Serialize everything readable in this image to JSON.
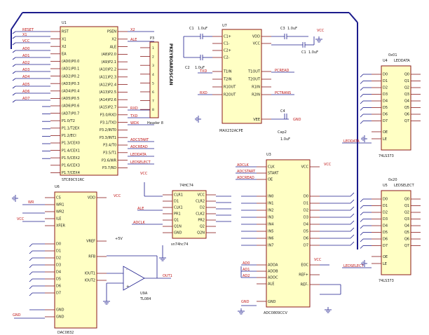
{
  "diagram": {
    "u1": {
      "ref": "U1",
      "part": "STC89C51RC",
      "left_pins": [
        "RST",
        "X1",
        "X2",
        "EA",
        "(AD0)P0.0",
        "(AD1)P0.1",
        "(AD2)P0.2",
        "(AD3)P0.3",
        "(AD4)P0.4",
        "(AD5)P0.5",
        "(AD6)P0.6",
        "(AD7)P0.7",
        "P1.0/T2",
        "P1.1/T2EX",
        "P1.2/ECI",
        "P1.3/CEX0",
        "P1.4/CEX1",
        "P1.5/CEX2",
        "P1.6/CEX3",
        "P1.7/CEX4"
      ],
      "right_pins": [
        "PSEN",
        "X2",
        "ALE",
        "(A8)P2.0",
        "(A9)P2.1",
        "(A10)P2.2",
        "(A11)P2.3",
        "(A12)P2.4",
        "(A13)P2.5",
        "(A14)P2.6",
        "(A15)P2.7",
        "P3.0/RXD",
        "P3.1/TXD",
        "P3.2/INT0",
        "P3.3/INT1",
        "P3.4/T0",
        "P3.5/T1",
        "P3.6/WR",
        "P3.7/RD"
      ],
      "left_nets": [
        "RESET",
        "X1",
        "VCC",
        "AD0",
        "AD1",
        "AD2",
        "AD3",
        "AD4",
        "AD5",
        "AD6",
        "AD7"
      ],
      "right_nets": [
        "X2",
        "ALE",
        "RXD",
        "TXD",
        "WDX",
        "ADCSTART",
        "ADCREAD",
        "LEDDATA",
        "LEDSELECT"
      ]
    },
    "p3": {
      "ref": "P3",
      "part": "Header 8",
      "label": "PKEYBOARDSCAN",
      "pins": [
        "1",
        "2",
        "3",
        "4",
        "5",
        "6",
        "7",
        "8"
      ]
    },
    "u7": {
      "ref": "U7",
      "part": "MAX232ACPE",
      "left_pins": [
        "C1+",
        "C1-",
        "C2+",
        "C2-",
        "T1IN",
        "T2IN",
        "R1OUT",
        "R2OUT"
      ],
      "right_pins": [
        "VDD",
        "VCC",
        "",
        "",
        "T1OUT",
        "T2OUT",
        "R1IN",
        "R2IN",
        "VEE"
      ],
      "left_nets": [
        "TXD",
        "RXD"
      ],
      "right_nets": [
        "PCREAD",
        "PCTRANS",
        "GND"
      ]
    },
    "caps": [
      {
        "ref": "C1",
        "value": "1.0uF"
      },
      {
        "ref": "C2",
        "value": "1.0uF"
      },
      {
        "ref": "C3",
        "value": "1.0uF"
      },
      {
        "ref": "C4",
        "value": "1.0uF"
      },
      {
        "ref": "Cap2",
        "value": "1.0uF"
      }
    ],
    "u4_top": {
      "ref": "U4",
      "part": "74LS373",
      "label": "LEDDATA",
      "top_label": "0x01",
      "left_pins": [
        "D0",
        "D1",
        "D2",
        "D3",
        "D4",
        "D5",
        "D6",
        "D7"
      ],
      "right_pins": [
        "Q0",
        "Q1",
        "Q2",
        "Q3",
        "Q4",
        "Q5",
        "Q6",
        "Q7"
      ],
      "ctrl": [
        "OE",
        "LE"
      ]
    },
    "u5_bot": {
      "ref": "U5",
      "part": "74LS373",
      "label": "LEDSELECT",
      "top_label": "0x20",
      "left_pins": [
        "D0",
        "D1",
        "D2",
        "D3",
        "D4",
        "D5",
        "D6",
        "D7"
      ],
      "right_pins": [
        "Q0",
        "Q1",
        "Q2",
        "Q3",
        "Q4",
        "Q5",
        "Q6",
        "Q7"
      ],
      "ctrl": [
        "OE",
        "LE"
      ],
      "nets": [
        "LEDDATA",
        "LEDSELECT"
      ]
    },
    "u6": {
      "ref": "U6",
      "part": "DAC0832",
      "left_pins": [
        "CS",
        "WR1",
        "WR2",
        "ILE",
        "XFER",
        "D0",
        "D1",
        "D2",
        "D3",
        "D4",
        "D5",
        "D6",
        "D7",
        "GND",
        "GND"
      ],
      "right_pins": [
        "VDD",
        "VREF",
        "RFB",
        "IOUT1",
        "IOUT2"
      ],
      "nets": [
        "VCC",
        "WR",
        "+5V",
        "VCC"
      ]
    },
    "u8": {
      "ref": "74HC74",
      "part": "sn74hc74",
      "left_pins": [
        "CLR1",
        "D1",
        "CLK1",
        "PR1",
        "Q1",
        "Q1N",
        "GND"
      ],
      "right_pins": [
        "VCC",
        "CLR2",
        "D2",
        "CLK2",
        "PR2",
        "Q2",
        "Q2N"
      ],
      "nets": [
        "VCC",
        "ALE",
        "ADCLK"
      ]
    },
    "u3": {
      "ref": "U3",
      "part": "ADC0809CCV",
      "left_pins": [
        "CLK",
        "START",
        "OE",
        "IN0",
        "IN1",
        "IN2",
        "IN3",
        "IN4",
        "IN5",
        "IN6",
        "IN7",
        "ADDA",
        "ADDB",
        "ADDC",
        "ALE"
      ],
      "right_pins": [
        "VCC",
        "D0",
        "D1",
        "D2",
        "D3",
        "D4",
        "D5",
        "D6",
        "D7",
        "EOC",
        "REF+",
        "REF-",
        "GND"
      ],
      "nets": [
        "ADCLK",
        "ADCSTART",
        "ADCREAD",
        "AD0",
        "AD1",
        "AD2",
        "GND",
        "VCC",
        "VCC",
        "GND"
      ]
    },
    "opamp": {
      "ref": "U9A",
      "part": "TL084",
      "output_net": "OUT1"
    },
    "gnd_label": "GND",
    "vcc_label": "VCC"
  }
}
